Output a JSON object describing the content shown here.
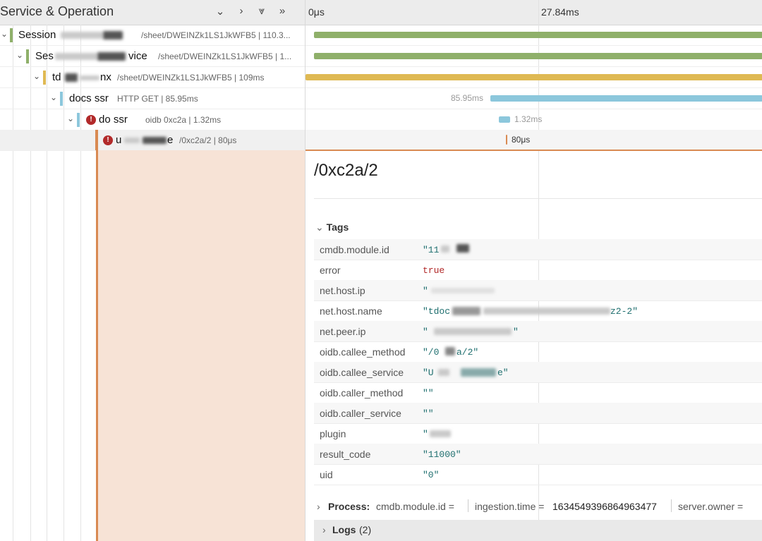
{
  "header": {
    "title": "Service & Operation",
    "tick_start": "0μs",
    "tick_mid": "27.84ms"
  },
  "rows": [
    {
      "service": "Session",
      "op": "/sheet/DWEINZk1LS1JkWFB5 | 110.3...",
      "color": "#8fb06a"
    },
    {
      "service": "Ses",
      "service_tail": "vice",
      "op": "/sheet/DWEINZk1LS1JkWFB5 | 1...",
      "color": "#8fb06a"
    },
    {
      "service": "td",
      "service_tail": "nx",
      "op": "/sheet/DWEINZk1LS1JkWFB5 | 109ms",
      "color": "#dfb953"
    },
    {
      "service": "docs ssr",
      "op": "HTTP GET | 85.95ms",
      "color": "#8cc7dc",
      "bar_label": "85.95ms"
    },
    {
      "service": "do ssr",
      "op": "oidb 0xc2a | 1.32ms",
      "color": "#8cc7dc",
      "bar_label": "1.32ms",
      "error": true
    },
    {
      "service": "u",
      "service_tail": "e",
      "op": "/0xc2a/2 | 80μs",
      "color": "#d98a52",
      "bar_label": "80μs",
      "error": true
    }
  ],
  "detail": {
    "title": "/0xc2a/2",
    "tags_label": "Tags",
    "tags": [
      {
        "key": "cmdb.module.id",
        "value": "\"11"
      },
      {
        "key": "error",
        "value": "true",
        "is_bool": true
      },
      {
        "key": "net.host.ip",
        "value": "\""
      },
      {
        "key": "net.host.name",
        "value": "\"tdoc",
        "value_tail": "z2-2\""
      },
      {
        "key": "net.peer.ip",
        "value": "\"",
        "value_tail": "\""
      },
      {
        "key": "oidb.callee_method",
        "value": "\"/0",
        "value_tail": "a/2\""
      },
      {
        "key": "oidb.callee_service",
        "value": "\"U",
        "value_tail": "e\""
      },
      {
        "key": "oidb.caller_method",
        "value": "\"\""
      },
      {
        "key": "oidb.caller_service",
        "value": "\"\""
      },
      {
        "key": "plugin",
        "value": "\""
      },
      {
        "key": "result_code",
        "value": "\"11000\""
      },
      {
        "key": "uid",
        "value": "\"0\""
      }
    ],
    "process_label": "Process:",
    "process_items": [
      "cmdb.module.id =",
      "ingestion.time =",
      "1634549396864963477",
      "server.owner ="
    ],
    "logs_label": "Logs",
    "logs_count": "(2)"
  }
}
